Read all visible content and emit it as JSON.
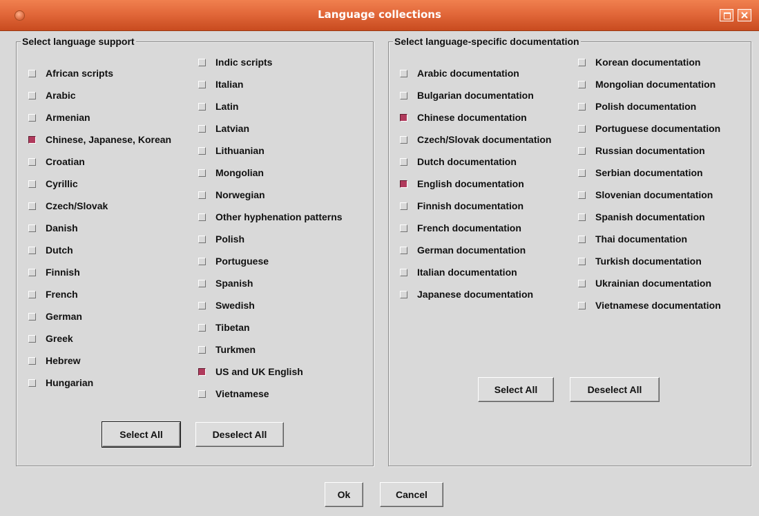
{
  "window": {
    "title": "Language collections"
  },
  "left_group": {
    "legend": "Select language support",
    "col1": [
      {
        "label": "African scripts",
        "checked": false
      },
      {
        "label": "Arabic",
        "checked": false
      },
      {
        "label": "Armenian",
        "checked": false
      },
      {
        "label": "Chinese, Japanese, Korean",
        "checked": true
      },
      {
        "label": "Croatian",
        "checked": false
      },
      {
        "label": "Cyrillic",
        "checked": false
      },
      {
        "label": "Czech/Slovak",
        "checked": false
      },
      {
        "label": "Danish",
        "checked": false
      },
      {
        "label": "Dutch",
        "checked": false
      },
      {
        "label": "Finnish",
        "checked": false
      },
      {
        "label": "French",
        "checked": false
      },
      {
        "label": "German",
        "checked": false
      },
      {
        "label": "Greek",
        "checked": false
      },
      {
        "label": "Hebrew",
        "checked": false
      },
      {
        "label": "Hungarian",
        "checked": false
      }
    ],
    "col2": [
      {
        "label": "Indic scripts",
        "checked": false
      },
      {
        "label": "Italian",
        "checked": false
      },
      {
        "label": "Latin",
        "checked": false
      },
      {
        "label": "Latvian",
        "checked": false
      },
      {
        "label": "Lithuanian",
        "checked": false
      },
      {
        "label": "Mongolian",
        "checked": false
      },
      {
        "label": "Norwegian",
        "checked": false
      },
      {
        "label": "Other hyphenation patterns",
        "checked": false
      },
      {
        "label": "Polish",
        "checked": false
      },
      {
        "label": "Portuguese",
        "checked": false
      },
      {
        "label": "Spanish",
        "checked": false
      },
      {
        "label": "Swedish",
        "checked": false
      },
      {
        "label": "Tibetan",
        "checked": false
      },
      {
        "label": "Turkmen",
        "checked": false
      },
      {
        "label": "US and UK English",
        "checked": true
      },
      {
        "label": "Vietnamese",
        "checked": false
      }
    ],
    "select_all": "Select All",
    "deselect_all": "Deselect All"
  },
  "right_group": {
    "legend": "Select language-specific documentation",
    "col1": [
      {
        "label": "Arabic documentation",
        "checked": false
      },
      {
        "label": "Bulgarian documentation",
        "checked": false
      },
      {
        "label": "Chinese documentation",
        "checked": true
      },
      {
        "label": "Czech/Slovak documentation",
        "checked": false
      },
      {
        "label": "Dutch documentation",
        "checked": false
      },
      {
        "label": "English documentation",
        "checked": true
      },
      {
        "label": "Finnish documentation",
        "checked": false
      },
      {
        "label": "French documentation",
        "checked": false
      },
      {
        "label": "German documentation",
        "checked": false
      },
      {
        "label": "Italian documentation",
        "checked": false
      },
      {
        "label": "Japanese documentation",
        "checked": false
      }
    ],
    "col2": [
      {
        "label": "Korean documentation",
        "checked": false
      },
      {
        "label": "Mongolian documentation",
        "checked": false
      },
      {
        "label": "Polish documentation",
        "checked": false
      },
      {
        "label": "Portuguese documentation",
        "checked": false
      },
      {
        "label": "Russian documentation",
        "checked": false
      },
      {
        "label": "Serbian documentation",
        "checked": false
      },
      {
        "label": "Slovenian documentation",
        "checked": false
      },
      {
        "label": "Spanish documentation",
        "checked": false
      },
      {
        "label": "Thai documentation",
        "checked": false
      },
      {
        "label": "Turkish documentation",
        "checked": false
      },
      {
        "label": "Ukrainian documentation",
        "checked": false
      },
      {
        "label": "Vietnamese documentation",
        "checked": false
      }
    ],
    "select_all": "Select All",
    "deselect_all": "Deselect All"
  },
  "footer": {
    "ok": "Ok",
    "cancel": "Cancel"
  },
  "colors": {
    "checked_fill": "#b03a5c",
    "titlebar": "#e2683a",
    "background": "#d9d9d9"
  }
}
